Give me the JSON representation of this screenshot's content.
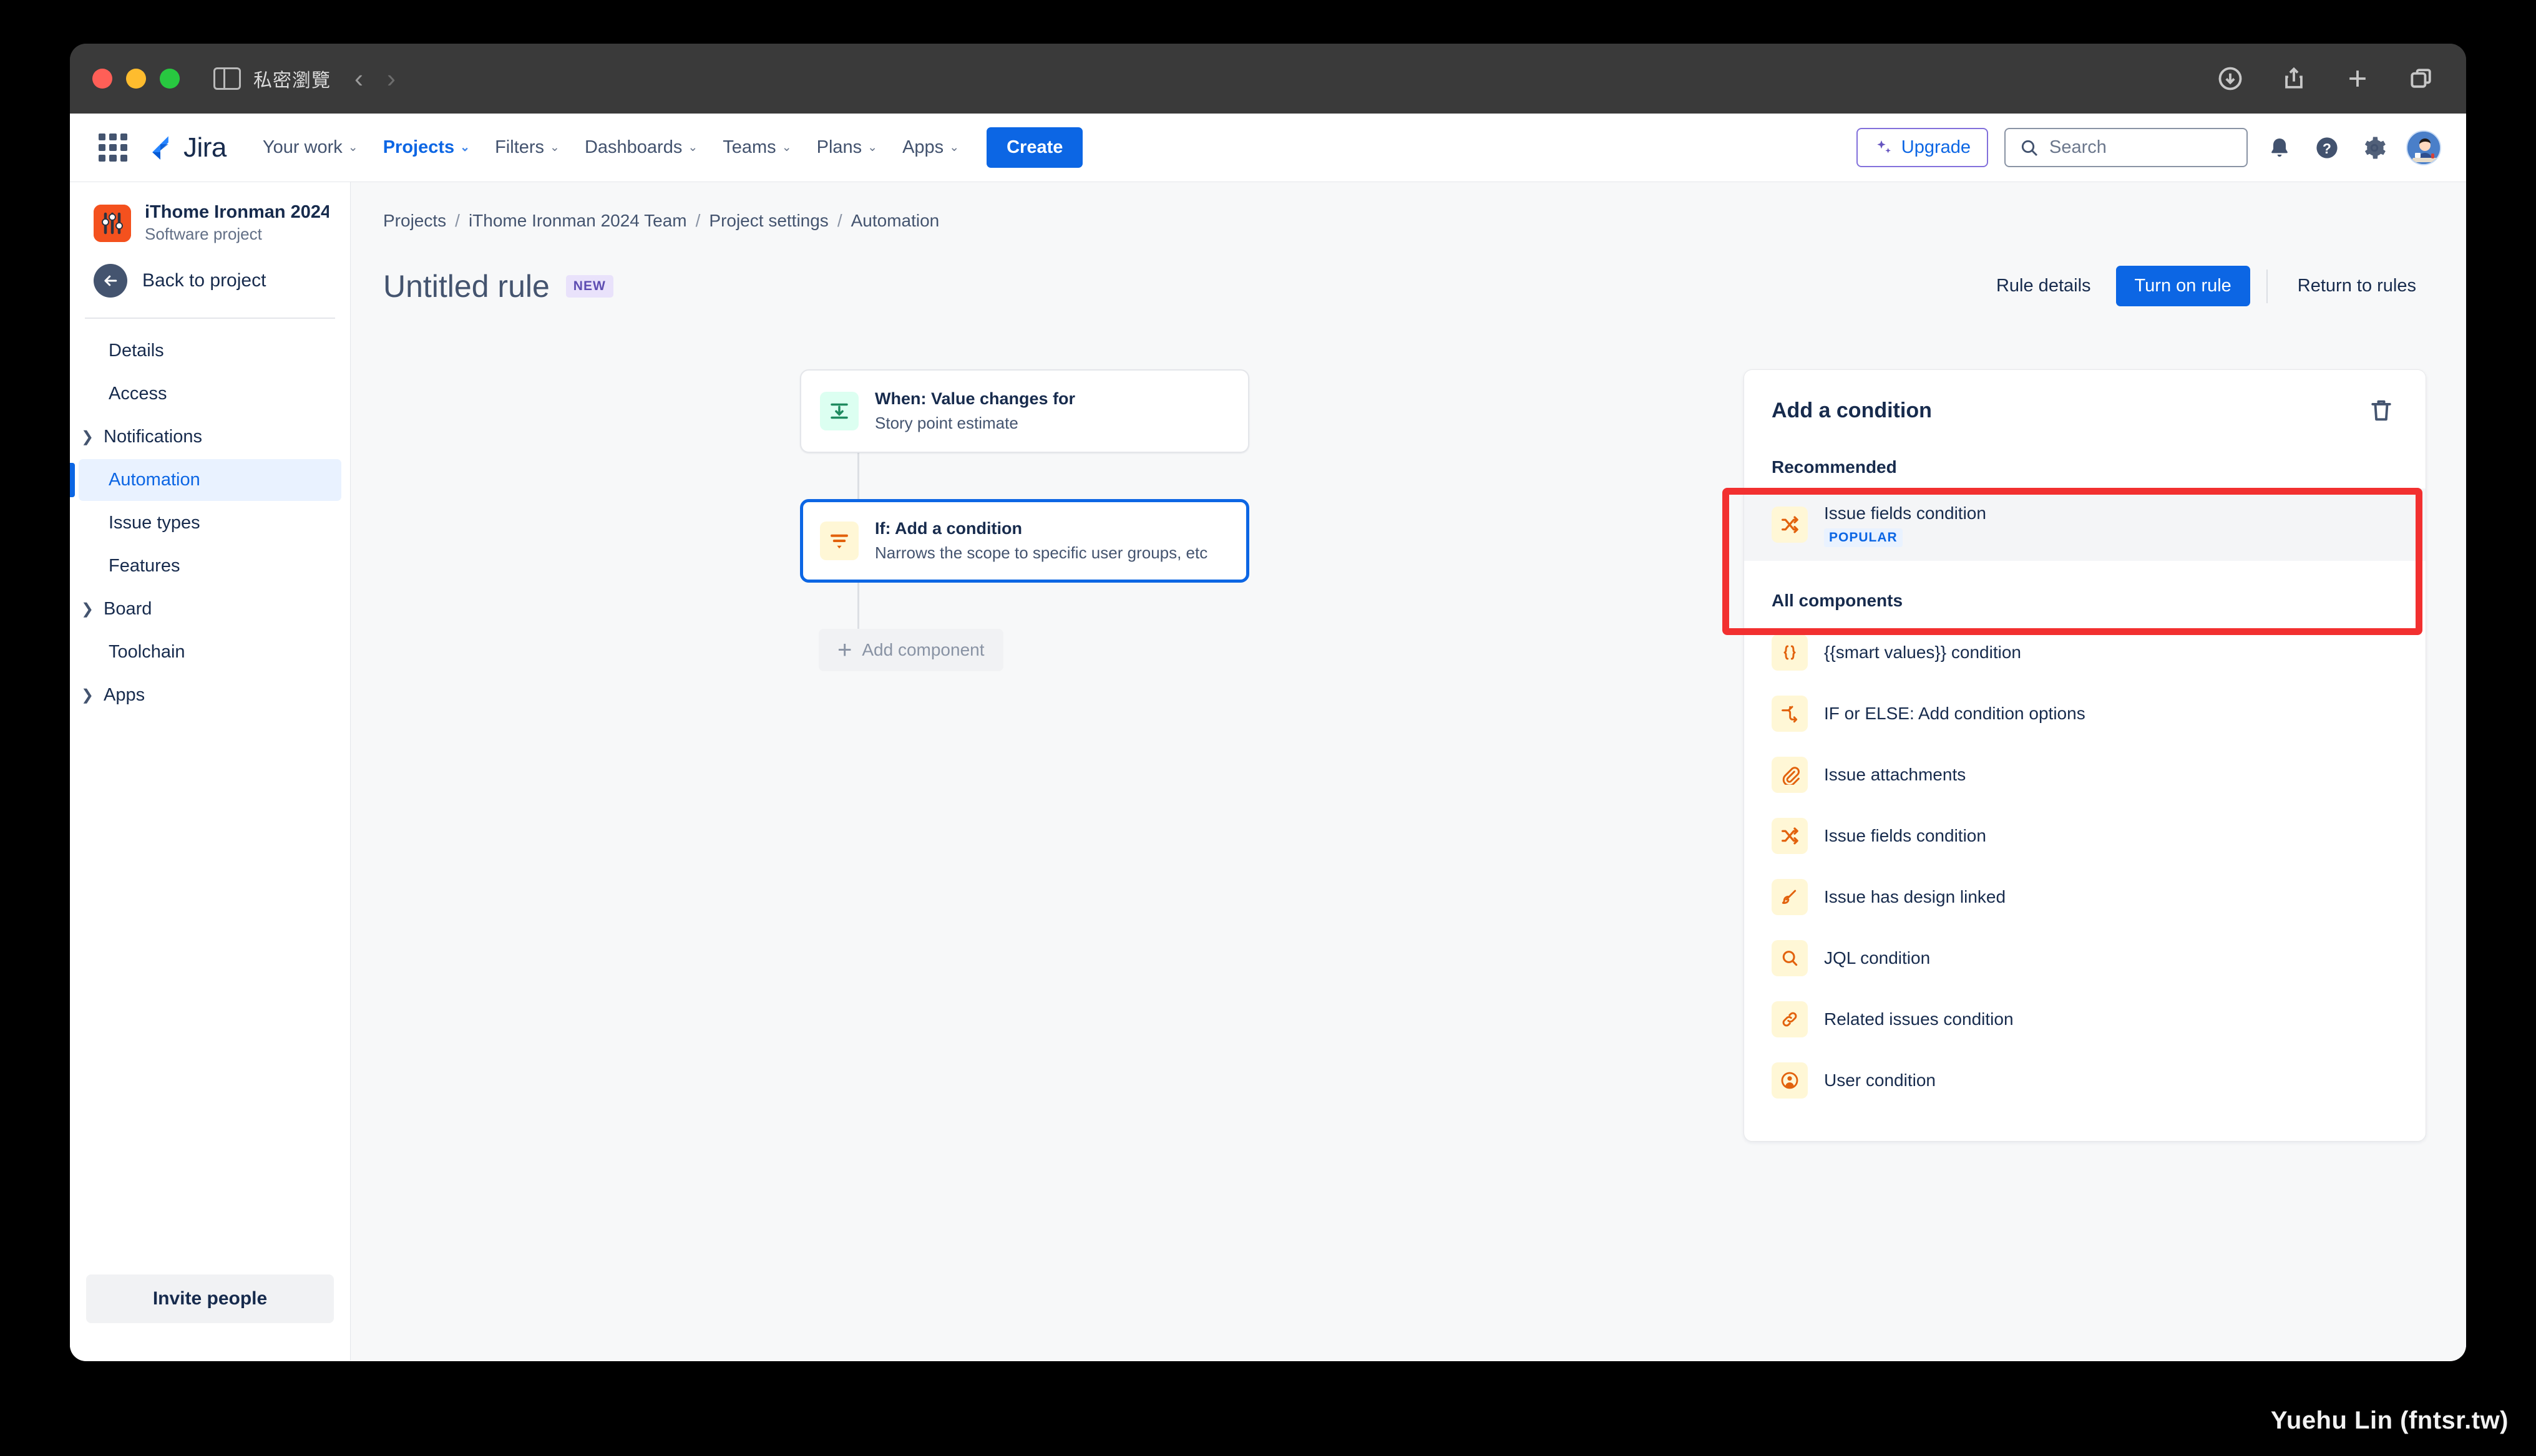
{
  "browser": {
    "private_label": "私密瀏覽",
    "back_glyph": "‹",
    "forward_glyph": "›",
    "icons": [
      "downloads-icon",
      "share-icon",
      "new-tab-icon",
      "tab-overview-icon"
    ]
  },
  "topnav": {
    "product_name": "Jira",
    "items": [
      {
        "label": "Your work",
        "has_caret": true,
        "active": false
      },
      {
        "label": "Projects",
        "has_caret": true,
        "active": true
      },
      {
        "label": "Filters",
        "has_caret": true,
        "active": false
      },
      {
        "label": "Dashboards",
        "has_caret": true,
        "active": false
      },
      {
        "label": "Teams",
        "has_caret": true,
        "active": false
      },
      {
        "label": "Plans",
        "has_caret": true,
        "active": false
      },
      {
        "label": "Apps",
        "has_caret": true,
        "active": false
      }
    ],
    "create_label": "Create",
    "upgrade_label": "Upgrade",
    "search_placeholder": "Search",
    "caret_glyph": "⌄"
  },
  "sidebar": {
    "project_name": "iThome Ironman 2024 ...",
    "project_type": "Software project",
    "back_label": "Back to project",
    "items": [
      {
        "label": "Details",
        "chevron": false,
        "active": false
      },
      {
        "label": "Access",
        "chevron": false,
        "active": false
      },
      {
        "label": "Notifications",
        "chevron": true,
        "active": false
      },
      {
        "label": "Automation",
        "chevron": false,
        "active": true
      },
      {
        "label": "Issue types",
        "chevron": false,
        "active": false
      },
      {
        "label": "Features",
        "chevron": false,
        "active": false
      },
      {
        "label": "Board",
        "chevron": true,
        "active": false
      },
      {
        "label": "Toolchain",
        "chevron": false,
        "active": false
      },
      {
        "label": "Apps",
        "chevron": true,
        "active": false
      }
    ],
    "chevron_glyph": "❯",
    "invite_label": "Invite people"
  },
  "breadcrumb": {
    "items": [
      "Projects",
      "iThome Ironman 2024 Team",
      "Project settings",
      "Automation"
    ],
    "separator": "/"
  },
  "page": {
    "title": "Untitled rule",
    "badge": "NEW",
    "actions": {
      "rule_details": "Rule details",
      "turn_on_rule": "Turn on rule",
      "return_to_rules": "Return to rules"
    }
  },
  "rule_canvas": {
    "cards": [
      {
        "title": "When: Value changes for",
        "subtitle": "Story point estimate",
        "icon": "value-changes-trigger-icon",
        "icon_tone": "green",
        "selected": false
      },
      {
        "title": "If: Add a condition",
        "subtitle": "Narrows the scope to specific user groups, etc",
        "icon": "condition-filter-icon",
        "icon_tone": "amber",
        "selected": true
      }
    ],
    "add_component_label": "Add component",
    "add_component_glyph": "+"
  },
  "right_panel": {
    "title": "Add a condition",
    "delete_icon": "trash-icon",
    "recommended_heading": "Recommended",
    "recommended": [
      {
        "label": "Issue fields condition",
        "badge": "POPULAR",
        "icon": "shuffle-icon"
      }
    ],
    "all_components_heading": "All components",
    "all_components": [
      {
        "label": "{{smart values}} condition",
        "icon": "braces-icon"
      },
      {
        "label": "IF or ELSE: Add condition options",
        "icon": "branch-icon"
      },
      {
        "label": "Issue attachments",
        "icon": "paperclip-icon"
      },
      {
        "label": "Issue fields condition",
        "icon": "shuffle-icon"
      },
      {
        "label": "Issue has design linked",
        "icon": "design-pen-icon"
      },
      {
        "label": "JQL condition",
        "icon": "magnifier-icon"
      },
      {
        "label": "Related issues condition",
        "icon": "link-icon"
      },
      {
        "label": "User condition",
        "icon": "user-circle-icon"
      }
    ]
  },
  "annotation": {
    "color": "#f23030"
  },
  "watermark": {
    "text": "Yuehu Lin (fntsr.tw)"
  },
  "colors": {
    "brand_blue": "#0c66e4",
    "jira_nav_text": "#42526e",
    "canvas_bg": "#f7f8f9",
    "icon_orange": "#e2620d",
    "icon_amber_bg": "#fff7d6",
    "trigger_green_bg": "#dcfff1",
    "project_icon": "#f4511e",
    "new_badge_bg": "#e9e2fb",
    "new_badge_text": "#5e4db2",
    "popular_badge_bg": "#e9f2ff"
  }
}
